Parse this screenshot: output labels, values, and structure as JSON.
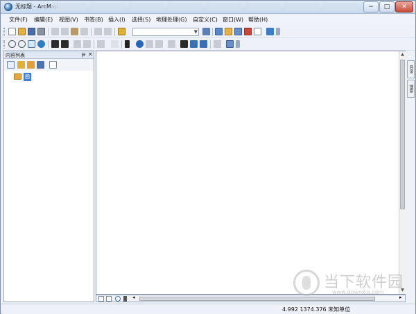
{
  "window": {
    "title": "无标题 - ArcMap",
    "minimize_glyph": "−",
    "maximize_glyph": "□",
    "close_glyph": "✕"
  },
  "menu": [
    "文件(F)",
    "编辑(E)",
    "视图(V)",
    "书签(B)",
    "插入(I)",
    "选择(S)",
    "地理处理(G)",
    "自定义(C)",
    "窗口(W)",
    "帮助(H)"
  ],
  "toolbar1": {
    "icons": [
      "new-document-icon",
      "open-icon",
      "save-icon",
      "print-icon",
      "cut-icon",
      "copy-icon",
      "paste-icon",
      "delete-icon",
      "undo-icon",
      "redo-icon",
      "add-data-icon",
      "map-scale-dropdown",
      "editor-toolbar-icon",
      "toc-window-icon",
      "catalog-window-icon",
      "search-window-icon",
      "arctoolbox-icon",
      "python-window-icon",
      "model-builder-icon"
    ],
    "scale_value": ""
  },
  "toolbar2": {
    "icons": [
      "zoom-in-icon",
      "zoom-out-icon",
      "pan-icon",
      "full-extent-icon",
      "fixed-zoom-in-icon",
      "fixed-zoom-out-icon",
      "back-icon",
      "forward-icon",
      "select-features-icon",
      "clear-selection-icon",
      "select-elements-icon",
      "identify-icon",
      "hyperlink-icon",
      "html-popup-icon",
      "measure-icon",
      "find-icon",
      "find-route-icon",
      "go-to-xy-icon",
      "time-slider-icon",
      "create-viewer-icon"
    ]
  },
  "toc": {
    "title": "内容列表",
    "pin_glyph": "ᵽ",
    "close_glyph": "✕",
    "tools": [
      "list-by-drawing-order-icon",
      "list-by-source-icon",
      "list-by-visibility-icon",
      "list-by-selection-icon",
      "options-icon"
    ],
    "layer": "图层"
  },
  "map_bottom_bar": {
    "buttons": [
      "data-view-icon",
      "layout-view-icon",
      "refresh-icon",
      "pause-drawing-icon"
    ],
    "scroll_left": "◂",
    "scroll_right": "▸"
  },
  "vscroll": {
    "up": "▲",
    "down": "▼"
  },
  "right_dock": {
    "tab1": "目录",
    "tab2": "搜索"
  },
  "status": {
    "coordinates": "4.992  1374.376 未知单位"
  },
  "watermark": {
    "name": "当下软件园",
    "url": "www.downxia.com"
  },
  "colors": {
    "accent": "#3c7fd4",
    "title_bar": "#c6d9ee",
    "close": "#c84b36"
  }
}
